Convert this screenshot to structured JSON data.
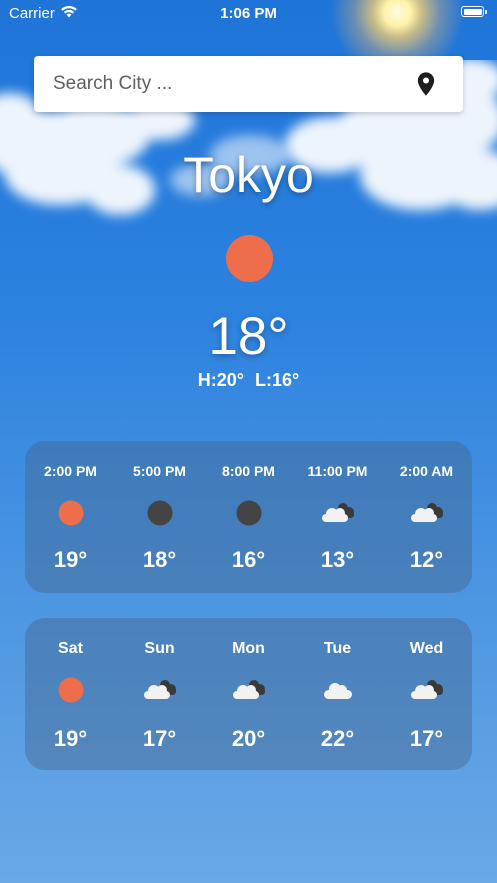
{
  "status_bar": {
    "carrier": "Carrier",
    "time": "1:06 PM"
  },
  "search": {
    "placeholder": "Search City ...",
    "value": ""
  },
  "current": {
    "city": "Tokyo",
    "temperature": "18°",
    "high": "H:20°",
    "low": "L:16°",
    "icon": "sun-icon"
  },
  "hourly": [
    {
      "time": "2:00 PM",
      "icon": "sun-icon",
      "temp": "19°"
    },
    {
      "time": "5:00 PM",
      "icon": "moon-icon",
      "temp": "18°"
    },
    {
      "time": "8:00 PM",
      "icon": "moon-icon",
      "temp": "16°"
    },
    {
      "time": "11:00 PM",
      "icon": "clouds-icon",
      "temp": "13°"
    },
    {
      "time": "2:00 AM",
      "icon": "clouds-icon",
      "temp": "12°"
    }
  ],
  "daily": [
    {
      "day": "Sat",
      "icon": "sun-icon",
      "temp": "19°"
    },
    {
      "day": "Sun",
      "icon": "clouds-icon",
      "temp": "17°"
    },
    {
      "day": "Mon",
      "icon": "clouds-icon",
      "temp": "20°"
    },
    {
      "day": "Tue",
      "icon": "cloud-icon",
      "temp": "22°"
    },
    {
      "day": "Wed",
      "icon": "clouds-icon",
      "temp": "17°"
    }
  ],
  "colors": {
    "sun": "#ee6e4c",
    "moon": "#444444",
    "cloud_front": "#f2f2f2",
    "cloud_back": "#3a3a3a"
  }
}
